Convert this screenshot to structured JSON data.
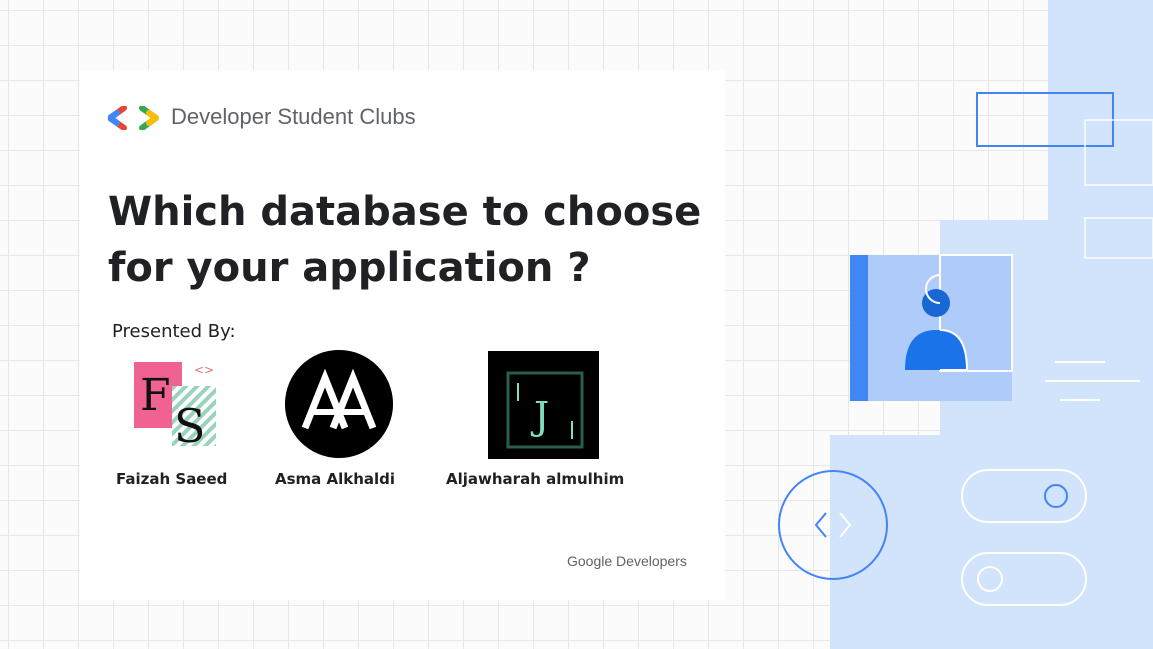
{
  "brand": {
    "logo_icon": "dsc-brackets-icon",
    "name": "Developer Student Clubs",
    "colors": {
      "blue": "#4285F4",
      "red": "#EA4335",
      "green": "#34A853",
      "yellow": "#FBBC04"
    }
  },
  "slide": {
    "title_line1": "Which database to choose",
    "title_line2": "for your application ?",
    "presented_by": "Presented By:"
  },
  "presenters": [
    {
      "name": "Faizah Saeed",
      "avatar": "fs-monogram-logo"
    },
    {
      "name": "Asma Alkhaldi",
      "avatar": "aa-monogram-logo"
    },
    {
      "name": "Aljawharah almulhim",
      "avatar": "j-monogram-logo"
    }
  ],
  "footer": {
    "google": "Google",
    "developers": "Developers"
  },
  "theme": {
    "panel": "#d2e3fc",
    "accent_blue": "#4285F4",
    "dark_blue": "#1967d2",
    "text": "#202124"
  }
}
